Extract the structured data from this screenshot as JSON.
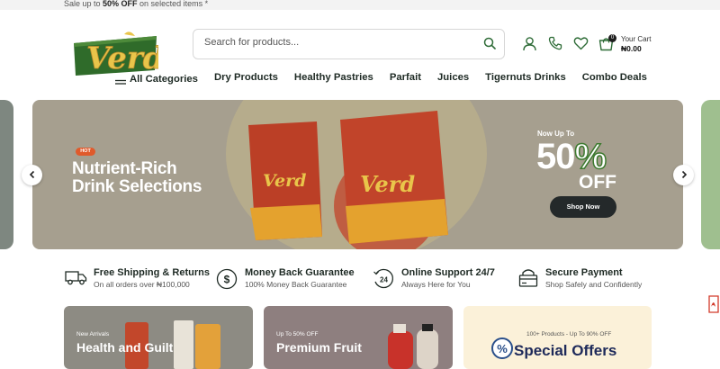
{
  "topbar": {
    "prefix": "Sale up to ",
    "highlight": "50% OFF",
    "suffix": " on selected items *"
  },
  "logo": {
    "text": "Verd"
  },
  "search": {
    "placeholder": "Search for products..."
  },
  "cart": {
    "label": "Your Cart",
    "amount": "₦0.00",
    "count": "0"
  },
  "nav": {
    "all_categories": "All Categories",
    "items": [
      "Dry Products",
      "Healthy Pastries",
      "Parfait",
      "Juices",
      "Tigernuts Drinks",
      "Combo Deals"
    ]
  },
  "hero": {
    "badge": "HOT",
    "title_line1": "Nutrient-Rich",
    "title_line2": "Drink Selections",
    "now_up_to": "Now Up To",
    "discount_num": "50",
    "discount_pct": "%",
    "off": "OFF",
    "cta": "Shop Now",
    "pack_text": "Verd"
  },
  "features": [
    {
      "title": "Free Shipping & Returns",
      "subtitle": "On all orders over ₦100,000",
      "icon": "truck-icon"
    },
    {
      "title": "Money Back Guarantee",
      "subtitle": "100% Money Back Guarantee",
      "icon": "dollar-circle-icon"
    },
    {
      "title": "Online Support 24/7",
      "subtitle": "Always Here for You",
      "icon": "support-24-icon"
    },
    {
      "title": "Secure Payment",
      "subtitle": "Shop Safely and Confidently",
      "icon": "secure-payment-icon"
    }
  ],
  "promo_cards": [
    {
      "small": "New Arrivals",
      "big": "Health and Guilt"
    },
    {
      "small": "Up To 50% OFF",
      "big": "Premium Fruit"
    },
    {
      "small": "100+ Products - Up To 90% OFF",
      "big": "Special Offers"
    }
  ],
  "colors": {
    "brand_green": "#3d7a2f",
    "hero_bg": "#a69f8f",
    "hot_badge": "#e05a2b",
    "button_dark": "#24292a"
  }
}
